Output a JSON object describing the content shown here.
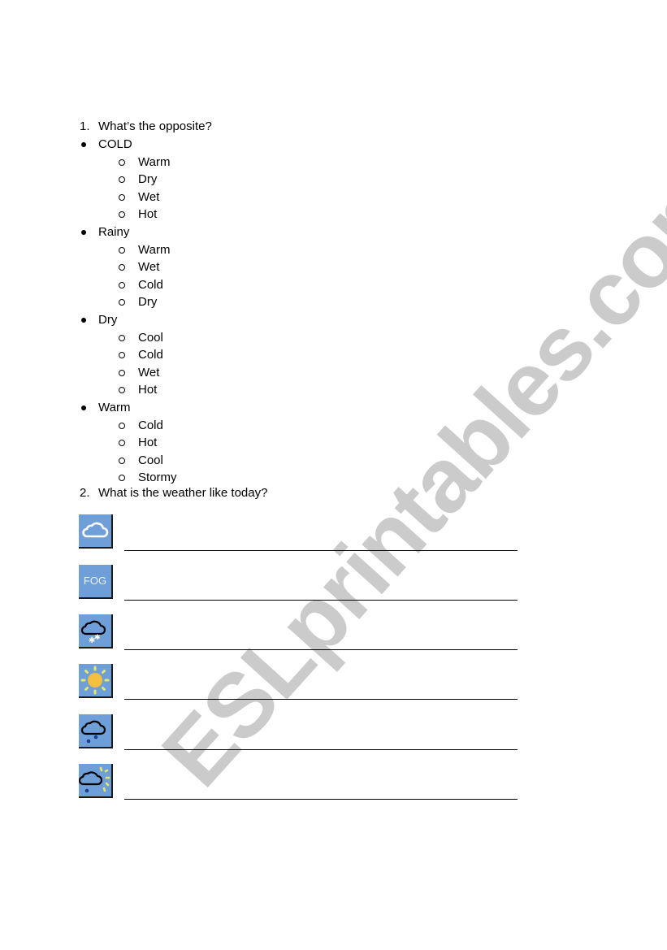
{
  "question1": {
    "number": "1.",
    "text": "What’s the opposite?",
    "groups": [
      {
        "word": "COLD",
        "options": [
          "Warm",
          "Dry",
          "Wet",
          "Hot"
        ]
      },
      {
        "word": "Rainy",
        "options": [
          "Warm",
          "Wet",
          "Cold",
          "Dry"
        ]
      },
      {
        "word": "Dry",
        "options": [
          "Cool",
          "Cold",
          "Wet",
          "Hot"
        ]
      },
      {
        "word": "Warm",
        "options": [
          "Cold",
          "Hot",
          "Cool",
          "Stormy"
        ]
      }
    ]
  },
  "question2": {
    "number": "2.",
    "text": "What is the weather like today?",
    "items": [
      {
        "icon": "cloud-icon"
      },
      {
        "icon": "fog-icon",
        "label": "FOG"
      },
      {
        "icon": "snow-cloud-icon"
      },
      {
        "icon": "sun-icon"
      },
      {
        "icon": "rain-cloud-icon"
      },
      {
        "icon": "rain-sun-cloud-icon"
      }
    ]
  },
  "watermark": "ESLprintables.com",
  "colors": {
    "icon_bg": "#6f9fd8",
    "sun": "#f5c040",
    "watermark": "#a0a0a0"
  }
}
